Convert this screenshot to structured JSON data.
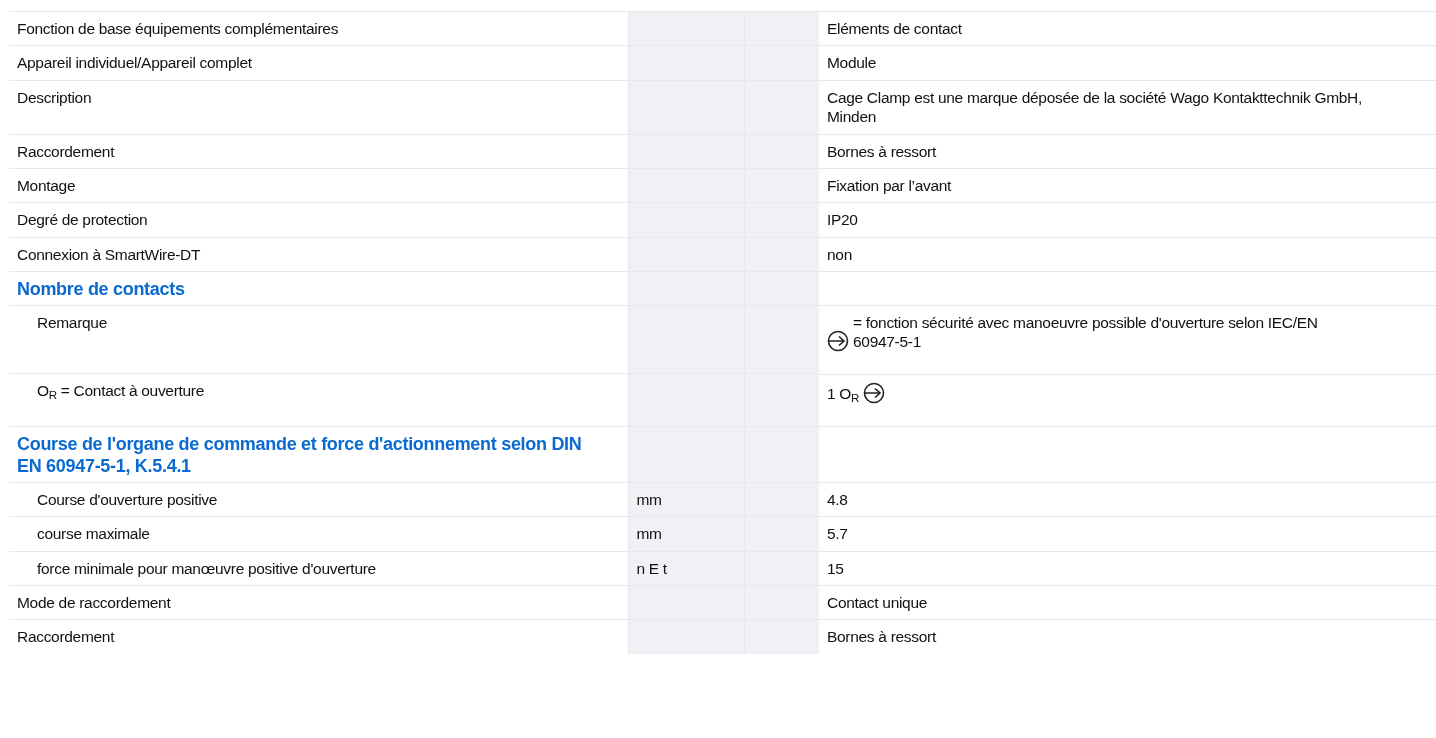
{
  "rows": [
    {
      "kind": "row",
      "label": "Fonction de base équipements complémentaires",
      "value": "Eléments de contact"
    },
    {
      "kind": "row",
      "label": "Appareil individuel/Appareil complet",
      "value": "Module"
    },
    {
      "kind": "row",
      "label": "Description",
      "value": "Cage Clamp est une marque déposée de la société Wago Kontakttechnik GmbH, Minden"
    },
    {
      "kind": "row",
      "label": "Raccordement",
      "value": "Bornes à ressort"
    },
    {
      "kind": "row",
      "label": "Montage",
      "value": "Fixation par l’avant"
    },
    {
      "kind": "row",
      "label": "Degré de protection",
      "value": "IP20"
    },
    {
      "kind": "row",
      "label": "Connexion à SmartWire-DT",
      "value": "non"
    },
    {
      "kind": "heading",
      "label": "Nombre de contacts",
      "children": [
        {
          "kind": "row",
          "label": "Remarque",
          "value_parts": [
            {
              "kind": "icon"
            },
            {
              "kind": "text",
              "text": "= fonction sécurité avec manoeuvre possible d'ouverture selon IEC/EN 60947-5-1"
            }
          ]
        },
        {
          "kind": "row",
          "label": "O$_{R}$ = Contact à ouverture",
          "value_parts": [
            {
              "kind": "text",
              "text": "1 O$_{R}$"
            },
            {
              "kind": "icon"
            }
          ]
        }
      ]
    },
    {
      "kind": "heading",
      "label": "Course de l'organe de commande et force d'actionnement selon DIN EN 60947-5-1, K.5.4.1",
      "children": [
        {
          "kind": "row",
          "label": "Course d'ouverture positive",
          "unit": "mm",
          "value": "4.8"
        },
        {
          "kind": "row",
          "label": "course maximale",
          "unit": "mm",
          "value": "5.7"
        },
        {
          "kind": "row",
          "label": "force minimale pour manœuvre positive d'ouverture",
          "unit": "n E t",
          "value": "15"
        }
      ]
    },
    {
      "kind": "row",
      "label": "Mode de raccordement",
      "value": "Contact unique"
    },
    {
      "kind": "row",
      "label": "Raccordement",
      "value": "Bornes à ressort"
    }
  ]
}
